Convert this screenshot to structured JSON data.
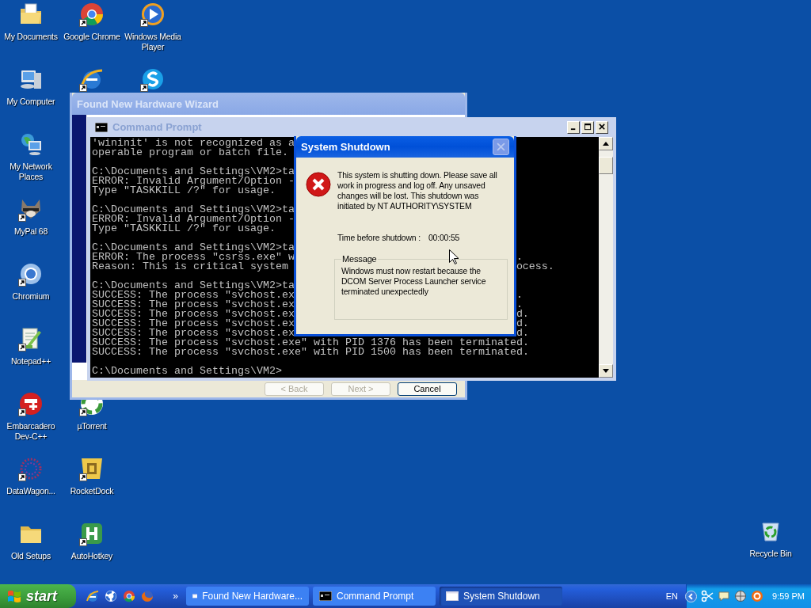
{
  "desktop_icons": [
    {
      "label": "My Documents",
      "shortcut": false
    },
    {
      "label": "My Computer",
      "shortcut": false
    },
    {
      "label": "My Network Places",
      "shortcut": false
    },
    {
      "label": "MyPal 68",
      "shortcut": true
    },
    {
      "label": "Chromium",
      "shortcut": true
    },
    {
      "label": "Notepad++",
      "shortcut": true
    },
    {
      "label": "Embarcadero Dev-C++",
      "shortcut": true
    },
    {
      "label": "DataWagon...",
      "shortcut": true
    },
    {
      "label": "Old Setups",
      "shortcut": false
    },
    {
      "label": "Google Chrome",
      "shortcut": true
    },
    {
      "shortcut": true
    },
    {
      "label": "µTorrent",
      "shortcut": true
    },
    {
      "label": "RocketDock",
      "shortcut": true
    },
    {
      "label": "AutoHotkey",
      "shortcut": true
    },
    {
      "label": "Windows Media Player",
      "shortcut": true
    },
    {
      "shortcut": true
    },
    {
      "label": "Recycle Bin",
      "shortcut": false
    }
  ],
  "wizard": {
    "title": "Found New Hardware Wizard",
    "active": false,
    "buttons": [
      {
        "label": "< Back",
        "disabled": true
      },
      {
        "label": "Next >",
        "disabled": true
      },
      {
        "label": "Cancel",
        "disabled": false
      }
    ]
  },
  "command_prompt": {
    "title": "Command Prompt",
    "active": false,
    "blocks": [
      [
        {
          "text": "'wininit' is not recognized as a"
        },
        {
          "text": "operable program or batch file."
        }
      ],
      [
        {
          "text": "C:\\Documents and Settings\\VM2>ta"
        },
        {
          "text": "ERROR: Invalid Argument/Option -"
        },
        {
          "text": "Type \"TASKKILL /?\" for usage."
        }
      ],
      [
        {
          "text": "C:\\Documents and Settings\\VM2>ta"
        },
        {
          "text": "ERROR: Invalid Argument/Option -"
        },
        {
          "text": "Type \"TASKKILL /?\" for usage."
        }
      ],
      [
        {
          "text": "C:\\Documents and Settings\\VM2>ta"
        },
        {
          "text": "ERROR: The process \"csrss.exe\" w",
          "tail": "."
        },
        {
          "text": "Reason: This is critical system",
          "tail": "ocess."
        }
      ],
      [
        {
          "text": "C:\\Documents and Settings\\VM2>ta"
        },
        {
          "text": "SUCCESS: The process \"svchost.ex",
          "tail": "."
        },
        {
          "text": "SUCCESS: The process \"svchost.ex",
          "tail": "."
        },
        {
          "text": "SUCCESS: The process \"svchost.ex",
          "tail": "d."
        },
        {
          "text": "SUCCESS: The process \"svchost.ex",
          "tail": "d."
        },
        {
          "text": "SUCCESS: The process \"svchost.ex",
          "tail": "d."
        },
        {
          "text": "SUCCESS: The process \"svchost.exe\" with PID 1376 has been terminated."
        },
        {
          "text": "SUCCESS: The process \"svchost.exe\" with PID 1500 has been terminated."
        }
      ],
      [
        {
          "text": "C:\\Documents and Settings\\VM2>"
        }
      ]
    ]
  },
  "shutdown_dialog": {
    "title": "System Shutdown",
    "active": true,
    "close_disabled": true,
    "message": "This system is shutting down. Please save all work in progress and log off. Any unsaved changes will be lost. This shutdown was initiated by NT AUTHORITY\\SYSTEM",
    "countdown_label": "Time before shutdown :",
    "countdown": "00:00:55",
    "group_label": "Message",
    "group_text": "Windows must now restart because the DCOM Server Process Launcher service terminated unexpectedly"
  },
  "taskbar": {
    "start_label": "start",
    "more": "»",
    "tasks": [
      {
        "label": "Found New Hardware...",
        "kind": "window",
        "selected": false
      },
      {
        "label": "Command Prompt",
        "kind": "console",
        "selected": false
      },
      {
        "label": "System Shutdown",
        "kind": "window",
        "selected": true
      }
    ],
    "language": "EN",
    "clock": "9:59 PM"
  }
}
